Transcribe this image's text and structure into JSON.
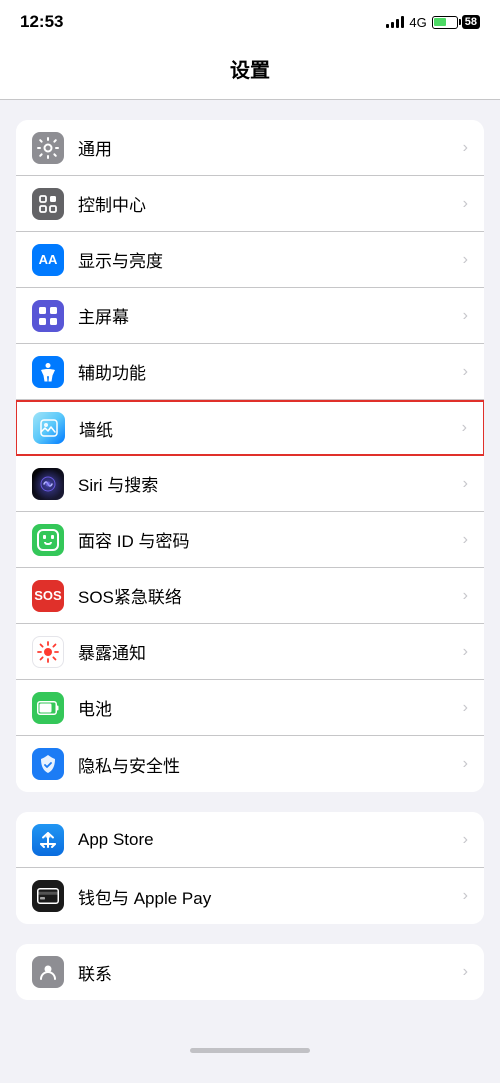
{
  "statusBar": {
    "time": "12:53",
    "signal": "4G",
    "battery": "58"
  },
  "navTitle": "设置",
  "sections": [
    {
      "id": "section1",
      "items": [
        {
          "id": "general",
          "label": "通用",
          "icon": "gear",
          "iconBg": "gray",
          "highlighted": false
        },
        {
          "id": "controlCenter",
          "label": "控制中心",
          "icon": "control",
          "iconBg": "gray2",
          "highlighted": false
        },
        {
          "id": "display",
          "label": "显示与亮度",
          "icon": "aa",
          "iconBg": "blue",
          "highlighted": false
        },
        {
          "id": "homeScreen",
          "label": "主屏幕",
          "icon": "grid",
          "iconBg": "indigo",
          "highlighted": false
        },
        {
          "id": "accessibility",
          "label": "辅助功能",
          "icon": "accessibility",
          "iconBg": "blue2",
          "highlighted": false
        },
        {
          "id": "wallpaper",
          "label": "墙纸",
          "icon": "wallpaper",
          "iconBg": "teal",
          "highlighted": true
        },
        {
          "id": "siri",
          "label": "Siri 与搜索",
          "icon": "siri",
          "iconBg": "siri",
          "highlighted": false
        },
        {
          "id": "faceId",
          "label": "面容 ID 与密码",
          "icon": "faceid",
          "iconBg": "green",
          "highlighted": false
        },
        {
          "id": "sos",
          "label": "SOS紧急联络",
          "icon": "sos",
          "iconBg": "red",
          "highlighted": false
        },
        {
          "id": "exposure",
          "label": "暴露通知",
          "icon": "exposure",
          "iconBg": "exposure",
          "highlighted": false
        },
        {
          "id": "battery",
          "label": "电池",
          "icon": "battery",
          "iconBg": "green2",
          "highlighted": false
        },
        {
          "id": "privacy",
          "label": "隐私与安全性",
          "icon": "privacy",
          "iconBg": "blue3",
          "highlighted": false
        }
      ]
    },
    {
      "id": "section2",
      "items": [
        {
          "id": "appStore",
          "label": "App Store",
          "icon": "appstore",
          "iconBg": "appstore",
          "highlighted": false
        },
        {
          "id": "wallet",
          "label": "钱包与 Apple Pay",
          "icon": "wallet",
          "iconBg": "black",
          "highlighted": false
        }
      ]
    },
    {
      "id": "section3",
      "items": [
        {
          "id": "contacts",
          "label": "联系",
          "icon": "contacts",
          "iconBg": "gray3",
          "highlighted": false
        }
      ]
    }
  ],
  "chevron": "›"
}
